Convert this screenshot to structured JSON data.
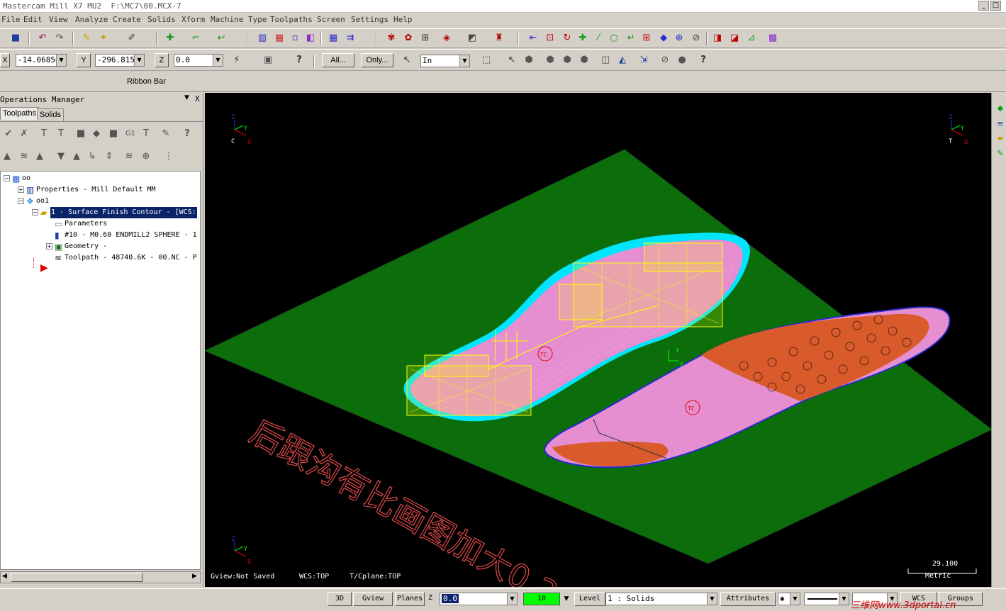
{
  "window": {
    "title": "Mastercam Mill X7 MU2  F:\\MC7\\00.MCX-7",
    "min_label": "_",
    "max_label": "□",
    "close_label": "×"
  },
  "menu": [
    "File",
    "Edit",
    "View",
    "Analyze",
    "Create",
    "Solids",
    "Xform",
    "Machine Type",
    "Toolpaths",
    "Screen",
    "Settings",
    "Help"
  ],
  "coords": {
    "x_label": "X",
    "x_value": "-14.06856",
    "y_label": "Y",
    "y_value": "-296.8150",
    "z_label": "Z",
    "z_value": "0.0",
    "all_label": "All...",
    "only_label": "Only...",
    "select_mode": "In"
  },
  "ribbon": {
    "label": "Ribbon Bar"
  },
  "ops_manager": {
    "header": "Operations Manager",
    "close": "X",
    "tabs": [
      "Toolpaths",
      "Solids"
    ],
    "tree": [
      {
        "label": "oo",
        "indent": 0,
        "pm": "−",
        "icon": "machine-group-icon"
      },
      {
        "label": "Properties - Mill Default MM",
        "indent": 1,
        "pm": "+",
        "icon": "properties-icon"
      },
      {
        "label": "oo1",
        "indent": 1,
        "pm": "−",
        "icon": "toolpath-group-icon"
      },
      {
        "label": "1 - Surface Finish Contour - [WCS:",
        "indent": 2,
        "pm": "−",
        "icon": "operation-folder-icon",
        "selected": true
      },
      {
        "label": "Parameters",
        "indent": 3,
        "pm": "",
        "icon": "parameters-icon"
      },
      {
        "label": "#10 - M0.60 ENDMILL2 SPHERE - 1",
        "indent": 3,
        "pm": "",
        "icon": "tool-icon"
      },
      {
        "label": "Geometry -",
        "indent": 3,
        "pm": "+",
        "icon": "geometry-icon"
      },
      {
        "label": "Toolpath - 48740.6K - 00.NC - P",
        "indent": 3,
        "pm": "",
        "icon": "toolpath-icon"
      }
    ],
    "insert_arrow": "▶",
    "scroll_left": "◀",
    "scroll_right": "▶"
  },
  "viewport": {
    "status_gview": "Gview:Not Saved",
    "status_wcs": "WCS:TOP",
    "status_tcplane": "T/Cplane:TOP",
    "scale_value": "29.100",
    "scale_units": "Metric",
    "annotation": "后跟沟有比画图加大0.3",
    "axis_z": "Z",
    "axis_y": "Y",
    "axis_x": "X",
    "axis_c": "C",
    "axis_t": "T",
    "marker_label": "TC"
  },
  "status": {
    "btn_3d": "3D",
    "btn_gview": "Gview",
    "btn_planes": "Planes",
    "z_label": "Z",
    "z_value": "0.0",
    "color_value": "10",
    "level_label": "Level",
    "level_value": "1 : Solids",
    "attributes_label": "Attributes",
    "wcs_label": "WCS",
    "groups_label": "Groups",
    "watermark": "三维网www.3dportal.cn"
  },
  "colors": {
    "viewport_bg": "#000000",
    "stock_green": "#0b6e0b",
    "toolpath_yellow": "#ffff00",
    "surface_pink": "#e58fd0",
    "pattern_orange": "#d95a2b",
    "cyan": "#00e5ff",
    "selection_blue": "#0a246a",
    "color_field": "#00ff00"
  }
}
